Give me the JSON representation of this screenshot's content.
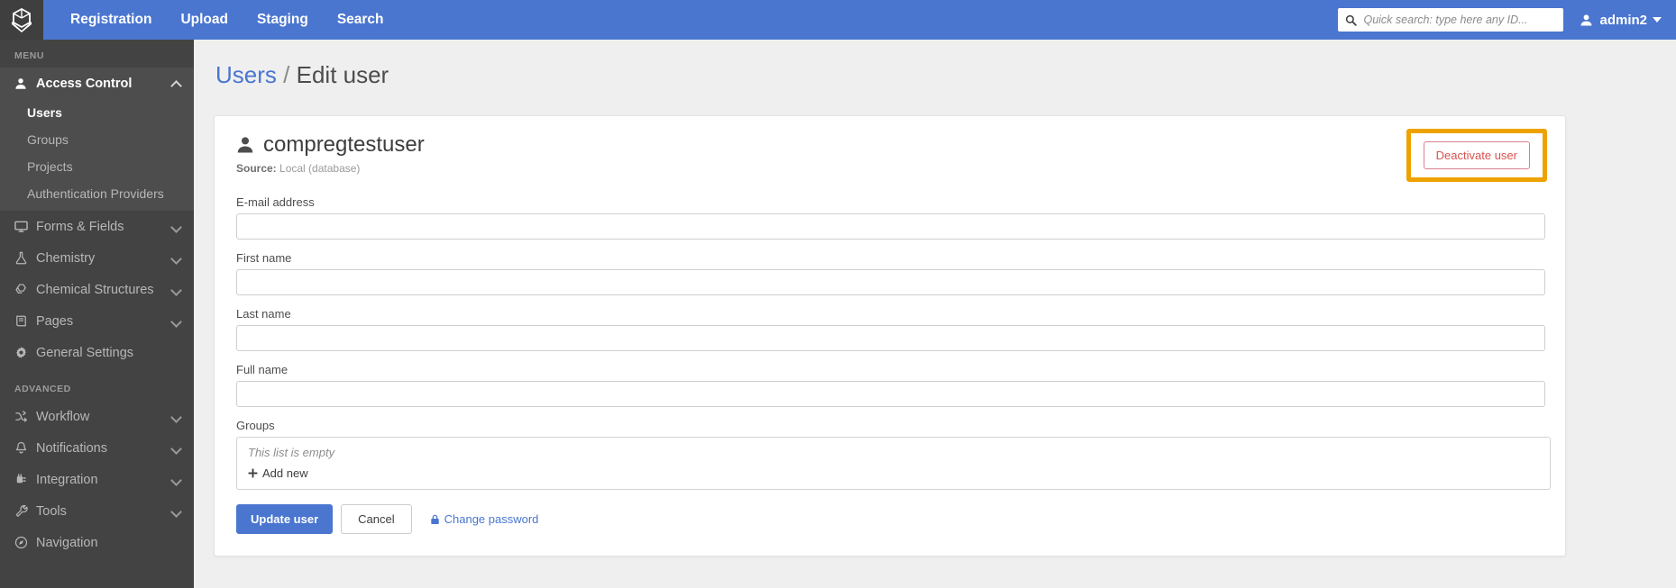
{
  "topbar": {
    "logo_icon": "cube-logo-icon",
    "nav": [
      {
        "label": "Registration"
      },
      {
        "label": "Upload"
      },
      {
        "label": "Staging"
      },
      {
        "label": "Search"
      }
    ],
    "search": {
      "icon": "search-icon",
      "placeholder": "Quick search: type here any ID...",
      "value": ""
    },
    "user": {
      "icon": "user-avatar-icon",
      "label": "admin2",
      "caret": "chevron-down-icon"
    },
    "bg_color": "#4a76d0"
  },
  "sidebar": {
    "menu_caption": "MENU",
    "advanced_caption": "ADVANCED",
    "bg_color": "#434343",
    "active_bg_color": "#4d4d4d",
    "menu_items": [
      {
        "label": "Access Control",
        "icon": "user-icon",
        "expanded": true,
        "chevron": "chevron-up-icon",
        "children": [
          {
            "label": "Users",
            "active": true
          },
          {
            "label": "Groups",
            "active": false
          },
          {
            "label": "Projects",
            "active": false
          },
          {
            "label": "Authentication Providers",
            "active": false
          }
        ]
      },
      {
        "label": "Forms & Fields",
        "icon": "monitor-icon",
        "chevron": "chevron-down-icon"
      },
      {
        "label": "Chemistry",
        "icon": "flask-icon",
        "chevron": "chevron-down-icon"
      },
      {
        "label": "Chemical Structures",
        "icon": "hexagon-stack-icon",
        "chevron": "chevron-down-icon"
      },
      {
        "label": "Pages",
        "icon": "book-icon",
        "chevron": "chevron-down-icon"
      },
      {
        "label": "General Settings",
        "icon": "gear-icon",
        "chevron": null
      }
    ],
    "advanced_items": [
      {
        "label": "Workflow",
        "icon": "shuffle-icon",
        "chevron": "chevron-down-icon"
      },
      {
        "label": "Notifications",
        "icon": "bell-icon",
        "chevron": "chevron-down-icon"
      },
      {
        "label": "Integration",
        "icon": "plug-icon",
        "chevron": "chevron-down-icon"
      },
      {
        "label": "Tools",
        "icon": "wrench-icon",
        "chevron": "chevron-down-icon"
      },
      {
        "label": "Navigation",
        "icon": "compass-icon",
        "chevron": null
      }
    ]
  },
  "breadcrumb": {
    "parent": "Users",
    "separator": "/",
    "current": "Edit user"
  },
  "card": {
    "user_icon": "user-icon",
    "username": "compregtestuser",
    "source_label": "Source:",
    "source_value": "Local (database)",
    "deactivate_button": {
      "label": "Deactivate user",
      "border_color": "#d98091",
      "text_color": "#d9534f",
      "highlight_color": "#eda200",
      "highlighted": true
    },
    "fields": [
      {
        "label": "E-mail address",
        "value": "",
        "placeholder": "",
        "name": "email-field"
      },
      {
        "label": "First name",
        "value": "",
        "placeholder": "",
        "name": "first-name-field"
      },
      {
        "label": "Last name",
        "value": "",
        "placeholder": "",
        "name": "last-name-field"
      },
      {
        "label": "Full name",
        "value": "",
        "placeholder": "",
        "name": "full-name-field"
      }
    ],
    "groups": {
      "label": "Groups",
      "empty_text": "This list is empty",
      "add_new_label": "Add new",
      "add_new_icon": "plus-icon"
    },
    "actions": {
      "update_label": "Update user",
      "cancel_label": "Cancel",
      "change_password_label": "Change password",
      "change_password_icon": "lock-icon",
      "primary_color": "#4a76d0",
      "link_color": "#4a76d0"
    }
  }
}
